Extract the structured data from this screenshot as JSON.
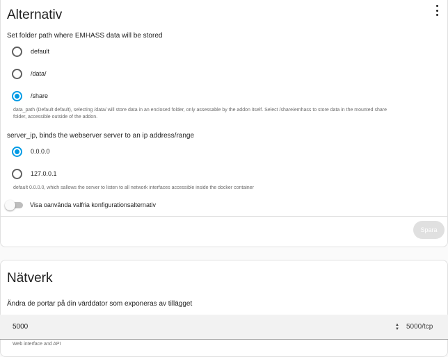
{
  "options_card": {
    "title": "Alternativ",
    "menu_icon": "more-vert-icon",
    "data_path": {
      "label": "Set folder path where EMHASS data will be stored",
      "options": [
        {
          "label": "default",
          "checked": false
        },
        {
          "label": "/data/",
          "checked": false
        },
        {
          "label": "/share",
          "checked": true
        }
      ],
      "helper_line1": "data_path (Default default), selecting /data/ will store data in an enclosed folder, only assessable by the addon itself. Select /share/emhass to store data in the mounted share",
      "helper_line2": "folder, accessible outside of the addon."
    },
    "server_ip": {
      "label": "server_ip, binds the webserver server to an ip address/range",
      "options": [
        {
          "label": "0.0.0.0",
          "checked": true
        },
        {
          "label": "127.0.0.1",
          "checked": false
        }
      ],
      "helper": "default 0.0.0.0, which sallows the server to listen to all network interfaces accessible inside the docker container"
    },
    "toggle_label": "Visa oanvända valfria konfigurationsalternativ",
    "toggle_on": false,
    "save_label": "Spara"
  },
  "network_card": {
    "title": "Nätverk",
    "description": "Ändra de portar på din värddator som exponeras av tillägget",
    "port_value": "5000",
    "port_suffix": "5000/tcp",
    "port_helper": "Web interface and API"
  },
  "colors": {
    "accent": "#039be5",
    "save_disabled": "#e0e0e0"
  }
}
